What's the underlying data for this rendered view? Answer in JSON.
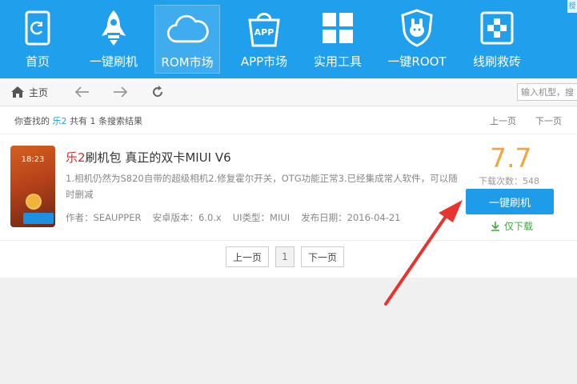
{
  "topnav": {
    "items": [
      {
        "label": "首页",
        "icon": "home-icon"
      },
      {
        "label": "一键刷机",
        "icon": "rocket-icon"
      },
      {
        "label": "ROM市场",
        "icon": "cloud-icon"
      },
      {
        "label": "APP市场",
        "icon": "app-bag-icon",
        "icon_text": "APP"
      },
      {
        "label": "实用工具",
        "icon": "tools-grid-icon"
      },
      {
        "label": "一键ROOT",
        "icon": "root-shield-icon"
      },
      {
        "label": "线刷救砖",
        "icon": "rescue-plus-icon"
      }
    ],
    "active_index": 2,
    "corner_tag": "授"
  },
  "navbar": {
    "home_label": "主页",
    "search_placeholder": "输入机型，搜"
  },
  "summary": {
    "prefix": "你查找的",
    "keyword": "乐2",
    "suffix": "共有 1 条搜索结果",
    "prev": "上一页",
    "next": "下一页"
  },
  "result": {
    "thumb_time": "18:23",
    "title_highlight": "乐2",
    "title_rest": "刷机包 真正的双卡MIUI V6",
    "description": "1.相机仍然为S820自带的超级相机2.修复霍尔开关，OTG功能正常3.已经集成常人软件，可以随时删减",
    "author": "作者：SEAUPPER",
    "android": "安卓版本：6.0.x",
    "ui_type": "UI类型：MIUI",
    "date": "发布日期：2016-04-21",
    "score": "7.7",
    "downloads": "下载次数：548",
    "flash_button": "一键刷机",
    "download_only": "仅下载"
  },
  "pager": {
    "prev": "上一页",
    "current": "1",
    "next": "下一页"
  },
  "colors": {
    "topbar": "#1f9fec",
    "score": "#f5a43a",
    "button": "#1e9cea",
    "keyword": "#1f9fec",
    "title_highlight": "#d42a2a",
    "download_only": "#3caa3c",
    "arrow": "#e8342f"
  }
}
